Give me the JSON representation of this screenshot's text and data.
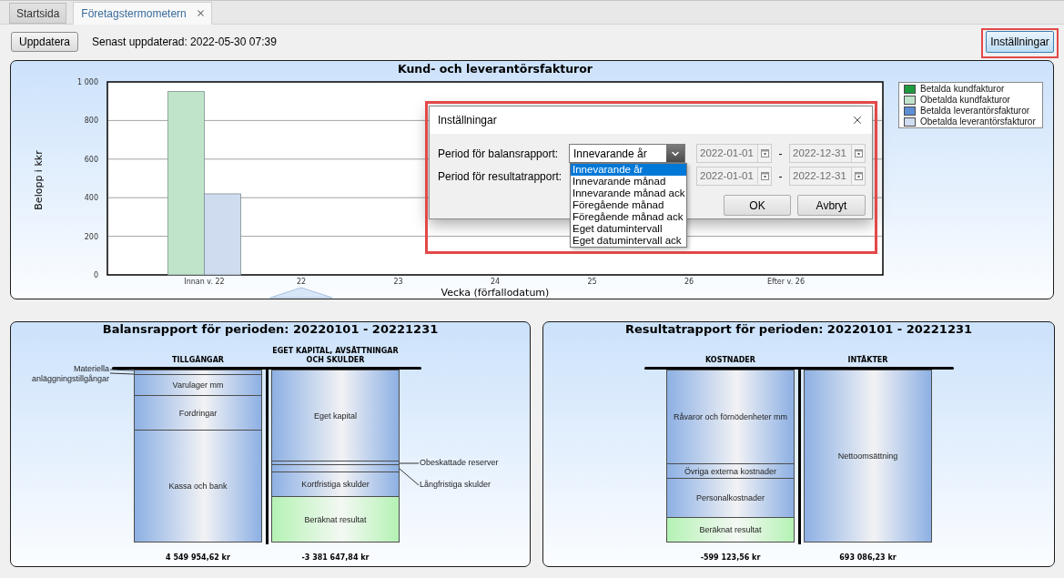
{
  "tabs": [
    {
      "label": "Startsida",
      "selected": false,
      "closable": false
    },
    {
      "label": "Företagstermometern",
      "selected": true,
      "closable": true
    }
  ],
  "toolbar": {
    "refresh_button": "Uppdatera",
    "last_updated": "Senast uppdaterad: 2022-05-30 07:39",
    "settings_button": "Inställningar"
  },
  "invoice_chart": {
    "chart_data": {
      "type": "bar",
      "title": "Kund- och leverantörsfakturor",
      "xlabel": "Vecka (förfallodatum)",
      "ylabel": "Belopp i kkr",
      "categories": [
        "Innan v. 22",
        "22",
        "23",
        "24",
        "25",
        "26",
        "Efter v. 26"
      ],
      "series": [
        {
          "name": "Betalda kundfakturor",
          "color": "#1f9a3f",
          "values": [
            0,
            0,
            0,
            0,
            0,
            0,
            0
          ]
        },
        {
          "name": "Obetalda kundfakturor",
          "color": "#c0e4c9",
          "values": [
            950,
            0,
            0,
            0,
            0,
            0,
            0
          ]
        },
        {
          "name": "Betalda leverantörsfakturor",
          "color": "#5f8fd4",
          "values": [
            0,
            0,
            0,
            0,
            0,
            0,
            0
          ]
        },
        {
          "name": "Obetalda leverantörsfakturor",
          "color": "#cfdcf0",
          "values": [
            420,
            0,
            0,
            0,
            0,
            0,
            0
          ]
        }
      ],
      "stacked": false,
      "grid": true,
      "legend": "right",
      "ylim": [
        0,
        1000
      ],
      "yticks": [
        0,
        200,
        400,
        600,
        800,
        {
          "value": 1000,
          "label": "1 000"
        }
      ]
    }
  },
  "settings_dialog": {
    "title": "Inställningar",
    "rows": [
      {
        "label": "Period för balansrapport:",
        "period": {
          "value": "Innevarande år",
          "expanded": true,
          "options": [
            {
              "label": "Innevarande år",
              "selected": true
            },
            {
              "label": "Innevarande månad",
              "selected": false
            },
            {
              "label": "Innevarande månad ack",
              "selected": false
            },
            {
              "label": "Föregående månad",
              "selected": false
            },
            {
              "label": "Föregående månad ack",
              "selected": false
            },
            {
              "label": "Eget datumintervall",
              "selected": false
            },
            {
              "label": "Eget datumintervall ack",
              "selected": false
            }
          ]
        },
        "from": {
          "value": "2022-01-01",
          "disabled": true
        },
        "separator": "-",
        "to": {
          "value": "2022-12-31",
          "disabled": true
        }
      },
      {
        "label": "Period för resultatrapport:",
        "from": {
          "value": "2022-01-01",
          "disabled": true
        },
        "separator": "-",
        "to": {
          "value": "2022-12-31",
          "disabled": true
        }
      }
    ],
    "buttons": [
      "OK",
      "Avbryt"
    ]
  },
  "balance_report": {
    "title": "Balansrapport för perioden: 20220101 - 20221231",
    "columns": [
      {
        "heading": "TILLGÅNGAR",
        "segments": [
          {
            "kind": "thin"
          },
          {
            "label": "Varulager mm",
            "kind": "block"
          },
          {
            "label": "Fordringar",
            "kind": "block"
          },
          {
            "label": "Kassa och bank",
            "kind": "block"
          }
        ],
        "callouts": [
          "Materiella anläggningstillgångar"
        ],
        "total": "4 549 954,62 kr"
      },
      {
        "heading": "EGET KAPITAL, AVSÄTTNINGAR OCH SKULDER",
        "segments": [
          {
            "label": "Eget kapital",
            "kind": "block"
          },
          {
            "kind": "thin"
          },
          {
            "kind": "thin"
          },
          {
            "label": "Kortfristiga skulder",
            "kind": "block"
          },
          {
            "label": "Beräknat resultat",
            "kind": "result"
          }
        ],
        "callouts": [
          "Obeskattade reserver",
          "Långfristiga skulder"
        ],
        "total": "-3 381 647,84 kr"
      }
    ]
  },
  "income_report": {
    "title": "Resultatrapport för perioden: 20220101 - 20221231",
    "columns": [
      {
        "heading": "KOSTNADER",
        "segments": [
          {
            "label": "Råvaror och förnödenheter mm",
            "kind": "block"
          },
          {
            "label": "Övriga externa kostnader",
            "kind": "block"
          },
          {
            "label": "Personalkostnader",
            "kind": "block"
          },
          {
            "label": "Beräknat resultat",
            "kind": "result"
          }
        ],
        "total": "-599 123,56 kr"
      },
      {
        "heading": "INTÄKTER",
        "segments": [
          {
            "label": "Nettoomsättning",
            "kind": "block"
          }
        ],
        "total": "693 086,23 kr"
      }
    ]
  }
}
